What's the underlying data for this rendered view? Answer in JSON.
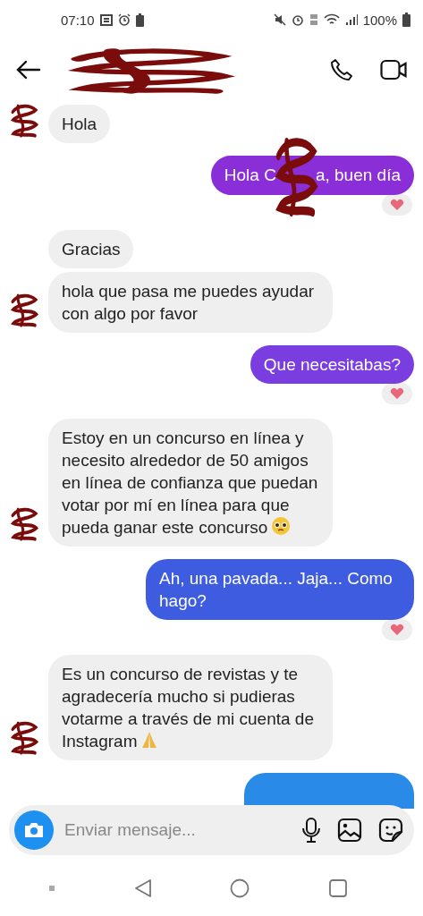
{
  "status_bar": {
    "time": "07:10",
    "battery": "100%"
  },
  "header": {
    "name_redacted": true
  },
  "messages": [
    {
      "kind": "incoming",
      "text": "Hola",
      "avatar": true,
      "reaction": false
    },
    {
      "kind": "outgoing",
      "text": "Hola C",
      "text_after": "a, buen día",
      "redacted": true,
      "color": "#8a2ed8",
      "reaction": true
    },
    {
      "kind": "incoming",
      "text": "Gracias",
      "avatar": false,
      "reaction": false
    },
    {
      "kind": "incoming",
      "text": "hola que pasa me puedes ayudar con algo por favor",
      "avatar": true,
      "reaction": false
    },
    {
      "kind": "outgoing",
      "text": "Que necesitabas?",
      "color": "#7a3de0",
      "reaction": true
    },
    {
      "kind": "incoming",
      "text": "Estoy en un concurso en línea y necesito alrededor de 50 amigos en línea de confianza que puedan votar por mí en línea para que pueda ganar este concurso",
      "emoji": {
        "kind": "pleading"
      },
      "avatar": true,
      "reaction": false
    },
    {
      "kind": "outgoing",
      "text": "Ah, una pavada... Jaja... Como hago?",
      "color": "#3d5ce0",
      "reaction": true
    },
    {
      "kind": "incoming",
      "text": "Es un concurso de revistas y te agradecería mucho si pudieras votarme a través de mi cuenta de Instagram",
      "emoji": {
        "kind": "praying"
      },
      "avatar": true,
      "reaction": false
    },
    {
      "kind": "outgoing_partial",
      "color": "#2a8ae8"
    }
  ],
  "composer": {
    "placeholder": "Enviar mensaje..."
  }
}
